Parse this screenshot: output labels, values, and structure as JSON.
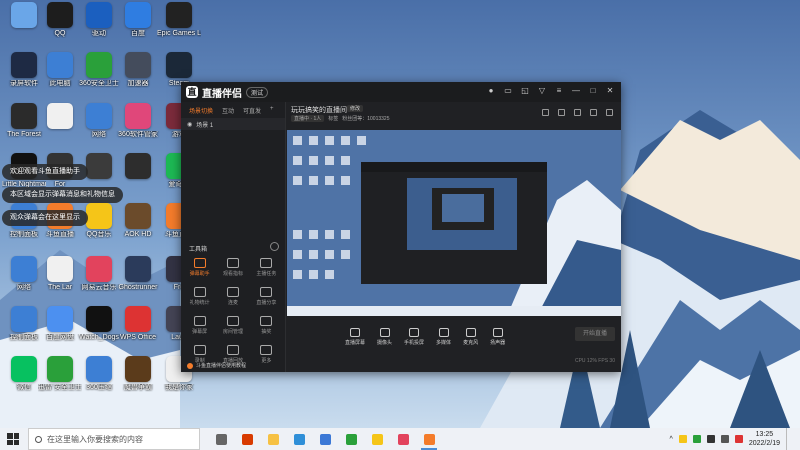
{
  "desktop_icons": [
    {
      "label": "",
      "icon": "recycle-bin-icon",
      "color": "#6aa6e8"
    },
    {
      "label": "QQ",
      "icon": "qq-icon",
      "color": "#1d1d1d"
    },
    {
      "label": "驱动",
      "icon": "driver-icon",
      "color": "#1b5fbf"
    },
    {
      "label": "百度",
      "icon": "app-icon",
      "color": "#2f7de1"
    },
    {
      "label": "Epic Games Launcher",
      "icon": "epic-games-icon",
      "color": "#222"
    },
    {
      "label": "录屏软件",
      "icon": "recorder-icon",
      "color": "#1e2a44"
    },
    {
      "label": "此电脑",
      "icon": "this-pc-icon",
      "color": "#3d7fd4"
    },
    {
      "label": "360安全卫士",
      "icon": "security-icon",
      "color": "#2aa03a"
    },
    {
      "label": "加速器",
      "icon": "booster-icon",
      "color": "#444c5c"
    },
    {
      "label": "Steam",
      "icon": "steam-icon",
      "color": "#1b2838"
    },
    {
      "label": "The Forest",
      "icon": "game-icon",
      "color": "#2b2b2b"
    },
    {
      "label": "",
      "icon": "document-icon",
      "color": "#f0f0f0"
    },
    {
      "label": "网络",
      "icon": "network-icon",
      "color": "#3d7fd4"
    },
    {
      "label": "360软件管家",
      "icon": "software-icon",
      "color": "#e0477a"
    },
    {
      "label": "游戏",
      "icon": "game-icon",
      "color": "#7b2b3b"
    },
    {
      "label": "Little Nightmares",
      "icon": "game-icon",
      "color": "#111"
    },
    {
      "label": "For",
      "icon": "game-icon",
      "color": "#333"
    },
    {
      "label": "",
      "icon": "app-icon",
      "color": "#3b3b3b"
    },
    {
      "label": "",
      "icon": "app-icon",
      "color": "#2d2d2d"
    },
    {
      "label": "爱奇艺",
      "icon": "iqiyi-icon",
      "color": "#1db954"
    },
    {
      "label": "控制面板",
      "icon": "control-panel-icon",
      "color": "#3d7fd4"
    },
    {
      "label": "斗鱼直播",
      "icon": "douyu-icon",
      "color": "#f47c2b"
    },
    {
      "label": "QQ音乐",
      "icon": "music-icon",
      "color": "#f5c518"
    },
    {
      "label": "AOK HD",
      "icon": "game-icon",
      "color": "#6b4b2b"
    },
    {
      "label": "斗鱼直播",
      "icon": "douyu-icon",
      "color": "#f47c2b"
    },
    {
      "label": "网络",
      "icon": "network-icon",
      "color": "#3d7fd4"
    },
    {
      "label": "The Lar",
      "icon": "document-icon",
      "color": "#f0f0f0"
    },
    {
      "label": "网易云音乐",
      "icon": "music-icon",
      "color": "#e2435d"
    },
    {
      "label": "Ghostrunner",
      "icon": "game-icon",
      "color": "#2b3b5b"
    },
    {
      "label": "Fro",
      "icon": "game-icon",
      "color": "#334"
    },
    {
      "label": "控制面板",
      "icon": "control-panel-icon",
      "color": "#3d7fd4"
    },
    {
      "label": "百度网盘",
      "icon": "cloud-icon",
      "color": "#4c90f0"
    },
    {
      "label": "Watch_Dogs",
      "icon": "game-icon",
      "color": "#111"
    },
    {
      "label": "WPS Office",
      "icon": "wps-icon",
      "color": "#d33"
    },
    {
      "label": "Laun",
      "icon": "app-icon",
      "color": "#445"
    },
    {
      "label": "微信",
      "icon": "wechat-icon",
      "color": "#07c160"
    },
    {
      "label": "迅雷 安全卫士",
      "icon": "thunder-icon",
      "color": "#2aa03a"
    },
    {
      "label": "360压缩",
      "icon": "archive-icon",
      "color": "#3d7fd4"
    },
    {
      "label": "魔兽争霸",
      "icon": "warcraft-icon",
      "color": "#5b3b1b"
    },
    {
      "label": "我是你家",
      "icon": "document-icon",
      "color": "#f0f0f0"
    }
  ],
  "notifications": [
    "欢迎观看斗鱼直播助手",
    "本区域会显示弹幕消息和礼物信息",
    "观众弹幕会在这里显示"
  ],
  "app": {
    "name": "直播伴侣",
    "version": "测试",
    "scene_tabs": [
      "场景切换",
      "互动",
      "可直发"
    ],
    "scene_item": "场景 1",
    "stream_title": "玩玩搞笑的直播间",
    "edit_tag": "修改",
    "meta": [
      "直播中 · 1人",
      "标签",
      "粉丝团等：10013325"
    ],
    "tools_header": "工具箱",
    "tools": [
      "弹幕助手",
      "观看指标",
      "主播任务",
      "礼物统计",
      "连麦",
      "直播分享",
      "弹幕屏",
      "房间管理",
      "抽奖",
      "录制",
      "直播回放",
      "更多"
    ],
    "tip": "斗鱼直播伴侣使用教程",
    "bottom_bar": [
      "直播屏幕",
      "摄像头",
      "手机投屏",
      "多媒体",
      "麦克风",
      "扬声器"
    ],
    "start_button": "开始直播",
    "status_line": "CPU 12%  FPS 30"
  },
  "taskbar": {
    "search_placeholder": "在这里输入你要搜索的内容",
    "apps": [
      {
        "icon": "task-view-icon",
        "color": "#666"
      },
      {
        "icon": "office-icon",
        "color": "#d83b01"
      },
      {
        "icon": "explorer-icon",
        "color": "#f6c144"
      },
      {
        "icon": "edge-icon",
        "color": "#2f8fd8"
      },
      {
        "icon": "mail-icon",
        "color": "#3b78d6"
      },
      {
        "icon": "360-icon",
        "color": "#2aa03a"
      },
      {
        "icon": "qq-music-icon",
        "color": "#f5c518"
      },
      {
        "icon": "163-music-icon",
        "color": "#e2435d"
      },
      {
        "icon": "douyu-icon",
        "color": "#f47c2b"
      }
    ],
    "time": "13:25",
    "date": "2022/2/19"
  }
}
